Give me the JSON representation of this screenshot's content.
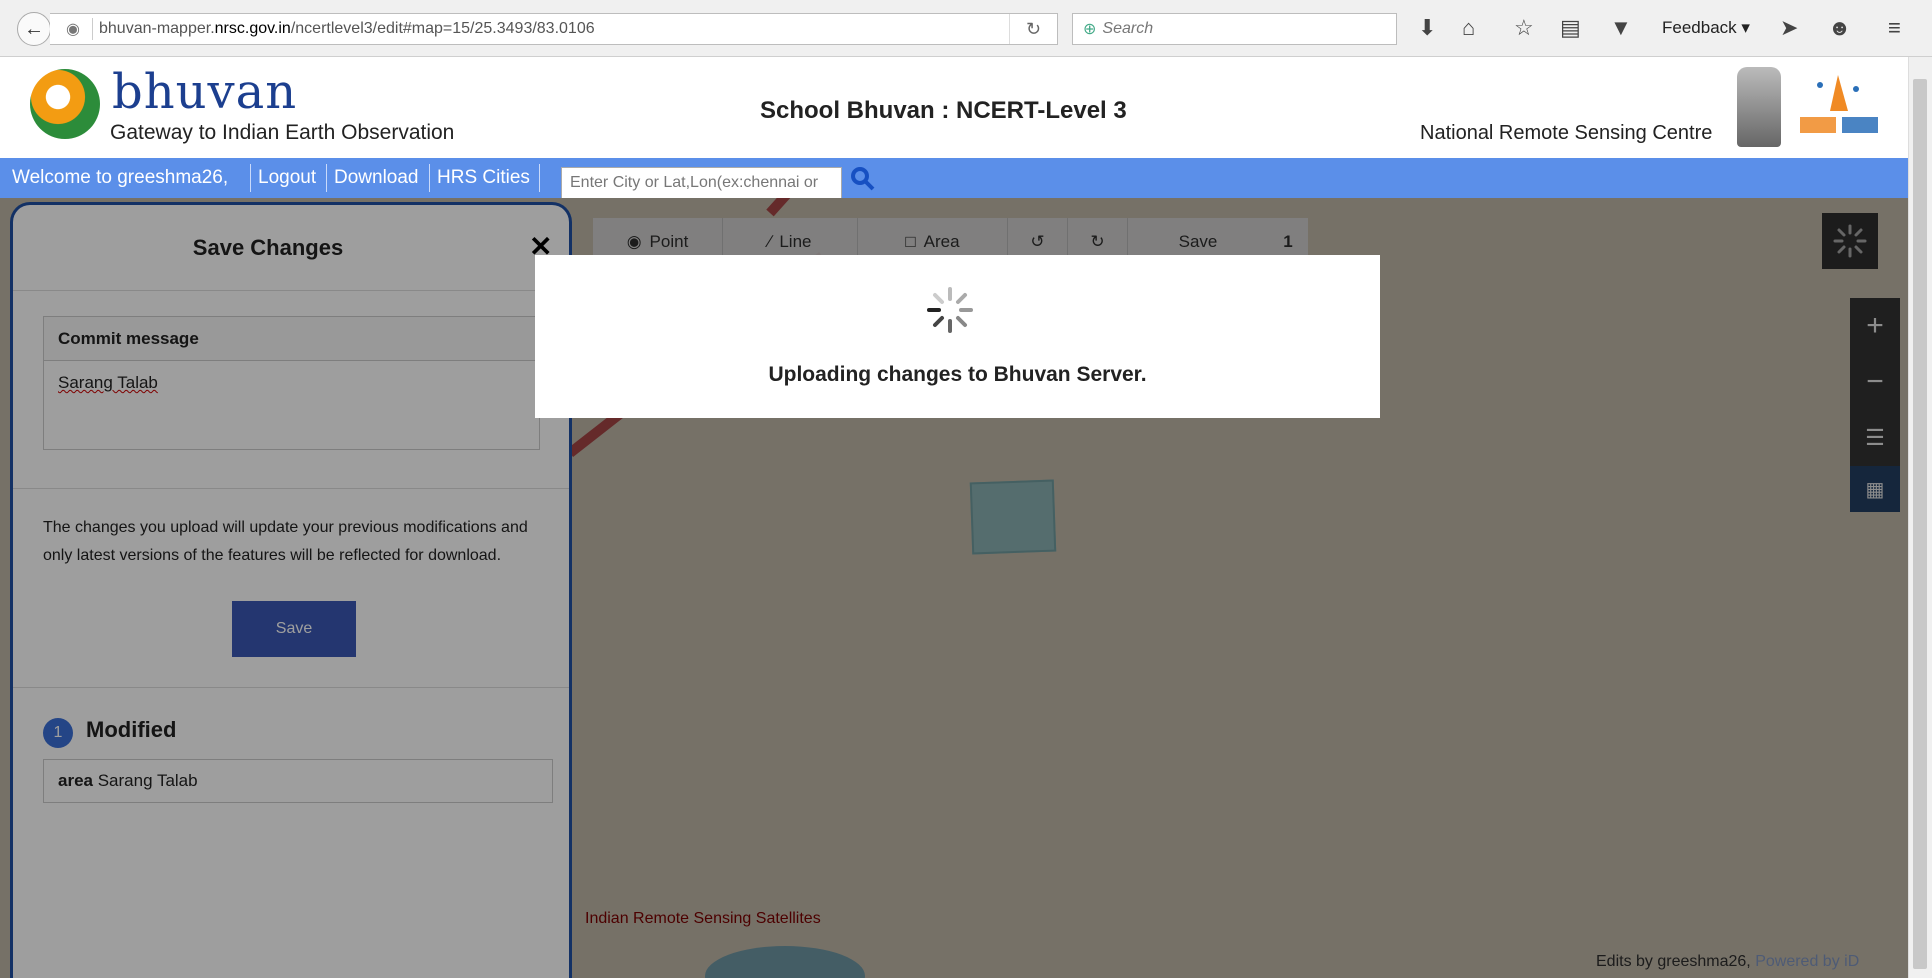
{
  "browser": {
    "url_prefix": "bhuvan-mapper.",
    "url_domain": "nrsc.gov.in",
    "url_path": "/ncertlevel3/edit#map=15/25.3493/83.0106",
    "search_placeholder": "Search",
    "feedback_label": "Feedback"
  },
  "header": {
    "logo_text": "bhuvan",
    "tagline": "Gateway to Indian Earth Observation",
    "title": "School Bhuvan : NCERT-Level 3",
    "org": "National Remote Sensing Centre"
  },
  "nav": {
    "welcome": "Welcome to greeshma26,",
    "logout": "Logout",
    "download": "Download",
    "hrs_cities": "HRS Cities",
    "search_placeholder": "Enter City or Lat,Lon(ex:chennai or"
  },
  "toolbar": {
    "point": "Point",
    "line": "Line",
    "area": "Area",
    "save": "Save",
    "count": "1"
  },
  "panel": {
    "title": "Save Changes",
    "commit_label": "Commit message",
    "commit_value": "Sarang Talab",
    "note": "The changes you upload will update your previous modifications and only latest versions of the features will be reflected for download.",
    "save_button": "Save",
    "modified_count": "1",
    "modified_title": "Modified",
    "modified_item_type": "area",
    "modified_item_name": "Sarang Talab"
  },
  "modal": {
    "message": "Uploading changes to Bhuvan Server."
  },
  "map": {
    "irs_label": "Indian Remote Sensing Satellites",
    "attribution_prefix": "Edits by greeshma26,",
    "attribution_link": "Powered by iD"
  }
}
